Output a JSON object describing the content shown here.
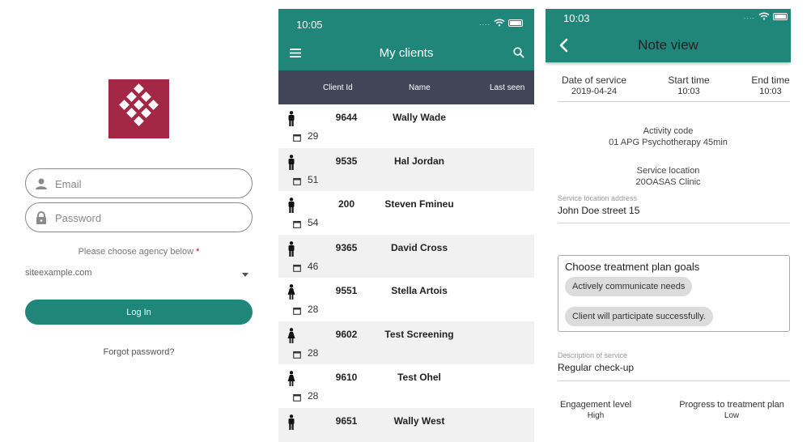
{
  "login": {
    "email_placeholder": "Email",
    "password_placeholder": "Password",
    "agency_label": "Please choose agency below",
    "agency_required_mark": "*",
    "agency_selected": "siteexample.com",
    "login_label": "Log In",
    "forgot_label": "Forgot password?",
    "logo_color": "#a32846"
  },
  "clients": {
    "status_time": "10:05",
    "title": "My clients",
    "columns": [
      "Client Id",
      "Name",
      "Last seen"
    ],
    "rows": [
      {
        "gender": "male",
        "id": "9644",
        "name": "Wally Wade",
        "age": "29"
      },
      {
        "gender": "male",
        "id": "9535",
        "name": "Hal Jordan",
        "age": "51"
      },
      {
        "gender": "male",
        "id": "200",
        "name": "Steven Fmineu",
        "age": "54"
      },
      {
        "gender": "male",
        "id": "9365",
        "name": "David Cross",
        "age": "46"
      },
      {
        "gender": "female",
        "id": "9551",
        "name": "Stella Artois",
        "age": "28"
      },
      {
        "gender": "female",
        "id": "9602",
        "name": "Test Screening",
        "age": "28"
      },
      {
        "gender": "female",
        "id": "9610",
        "name": "Test Ohel",
        "age": "28"
      },
      {
        "gender": "male",
        "id": "9651",
        "name": "Wally West",
        "age": ""
      }
    ],
    "header_color": "#404658",
    "accent": "#21867a"
  },
  "note": {
    "status_time": "10:03",
    "title": "Note view",
    "date_of_service_label": "Date of service",
    "date_of_service": "2019-04-24",
    "start_time_label": "Start time",
    "start_time": "10:03",
    "end_time_label": "End time",
    "end_time": "10:03",
    "activity_code_label": "Activity code",
    "activity_code": "01 APG Psychotherapy 45min",
    "service_location_label": "Service location",
    "service_location": "20OASAS Clinic",
    "service_location_address_label": "Service location address",
    "service_location_address": "John Doe street 15",
    "goals_title": "Choose treatment plan goals",
    "goals": [
      "Actively communicate needs",
      "Client will participate successfully."
    ],
    "description_label": "Description of service",
    "description": "Regular check-up",
    "engagement_label": "Engagement level",
    "engagement": "High",
    "progress_label": "Progress to treatment plan",
    "progress": "Low"
  }
}
